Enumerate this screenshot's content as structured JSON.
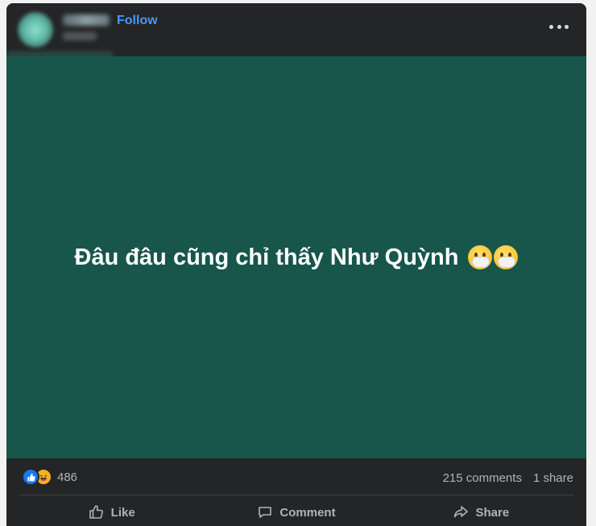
{
  "header": {
    "follow_label": "Follow",
    "more_icon": "more-horizontal-icon"
  },
  "post": {
    "text": "Đâu đâu cũng chỉ thấy Như Quỳnh",
    "emoji": [
      "face-with-hand-over-mouth-icon",
      "face-with-hand-over-mouth-icon"
    ],
    "background_color": "#18554b"
  },
  "stats": {
    "reaction_icons": [
      "like-reaction-icon",
      "haha-reaction-icon"
    ],
    "reaction_count": "486",
    "comments": "215 comments",
    "shares": "1 share"
  },
  "actions": {
    "like_label": "Like",
    "comment_label": "Comment",
    "share_label": "Share"
  },
  "colors": {
    "card_bg": "#242526",
    "accent": "#4599ff",
    "muted_text": "#b0b3b8",
    "like_blue": "#1877f2",
    "haha_yellow": "#f7b125"
  }
}
